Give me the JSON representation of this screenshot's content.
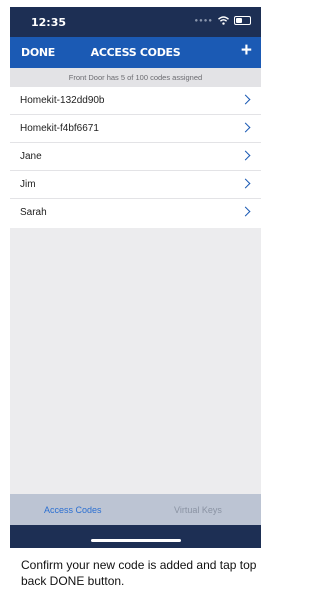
{
  "status_bar": {
    "time": "12:35",
    "icons": [
      "signal-dots-icon",
      "wifi-icon",
      "battery-icon"
    ]
  },
  "nav": {
    "done_label": "DONE",
    "title": "ACCESS CODES",
    "add_label": "+"
  },
  "info": {
    "text": "Front Door has 5 of 100 codes assigned"
  },
  "codes": [
    {
      "name": "Homekit-132dd90b"
    },
    {
      "name": "Homekit-f4bf6671"
    },
    {
      "name": "Jane"
    },
    {
      "name": "Jim"
    },
    {
      "name": "Sarah"
    }
  ],
  "tabs": {
    "access_codes": "Access Codes",
    "virtual_keys": "Virtual Keys"
  },
  "caption": "Confirm your new code is added and tap top back DONE button.",
  "colors": {
    "nav_blue": "#1b5ab4",
    "status_navy": "#1d2f54",
    "tab_active": "#2b6fd1"
  }
}
